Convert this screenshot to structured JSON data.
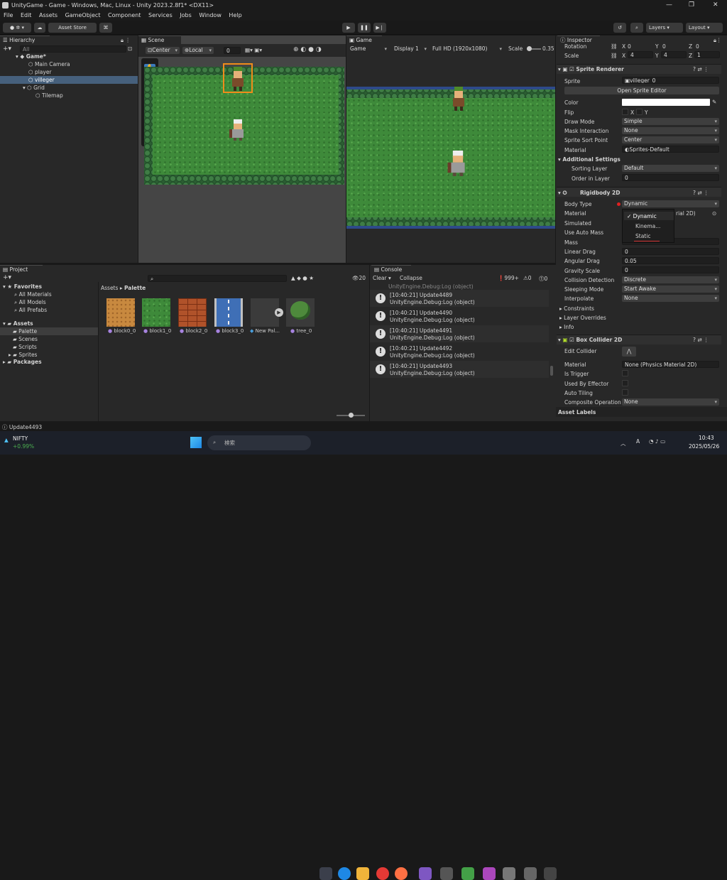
{
  "window": {
    "title": "UnityGame - Game - Windows, Mac, Linux - Unity 2023.2.8f1* <DX11>"
  },
  "menu": [
    "File",
    "Edit",
    "Assets",
    "GameObject",
    "Component",
    "Services",
    "Jobs",
    "Window",
    "Help"
  ],
  "toolbar": {
    "asset_store": "Asset Store",
    "layers": "Layers",
    "layout": "Layout"
  },
  "hierarchy": {
    "tab": "Hierarchy",
    "search_placeholder": "All",
    "items": [
      {
        "label": "Game*"
      },
      {
        "label": "Main Camera"
      },
      {
        "label": "player"
      },
      {
        "label": "villeger"
      },
      {
        "label": "Grid"
      },
      {
        "label": "Tilemap"
      }
    ]
  },
  "scene": {
    "tab": "Scene",
    "pivot": "Center",
    "space": "Local",
    "snap": "0"
  },
  "game": {
    "tab": "Game",
    "mode": "Game",
    "display": "Display 1",
    "resolution": "Full HD (1920x1080)",
    "scale_label": "Scale",
    "scale_value": "0.35"
  },
  "inspector": {
    "tab": "Inspector",
    "transform": {
      "rotation": "Rotation",
      "scale": "Scale",
      "rx": "0",
      "ry": "0",
      "rz": "0",
      "sx": "4",
      "sy": "4",
      "sz": "1",
      "x": "X",
      "y": "Y",
      "z": "Z"
    },
    "sprite_renderer": {
      "title": "Sprite Renderer",
      "sprite_label": "Sprite",
      "sprite_value": "villeger_0",
      "open_editor": "Open Sprite Editor",
      "color": "Color",
      "flip": "Flip",
      "flip_x": "X",
      "flip_y": "Y",
      "draw_mode": "Draw Mode",
      "draw_mode_value": "Simple",
      "mask_interaction": "Mask Interaction",
      "mask_value": "None",
      "sort_point": "Sprite Sort Point",
      "sort_point_value": "Center",
      "material": "Material",
      "material_value": "Sprites-Default",
      "additional": "Additional Settings",
      "sorting_layer": "Sorting Layer",
      "sorting_layer_value": "Default",
      "order": "Order in Layer",
      "order_value": "0"
    },
    "rigidbody": {
      "title": "Rigidbody 2D",
      "body_type": "Body Type",
      "body_type_value": "Dynamic",
      "material": "Material",
      "material_partial": "rial 2D)",
      "simulated": "Simulated",
      "auto_mass": "Use Auto Mass",
      "mass": "Mass",
      "linear_drag": "Linear Drag",
      "linear_drag_value": "0",
      "angular_drag": "Angular Drag",
      "angular_drag_value": "0.05",
      "gravity": "Gravity Scale",
      "gravity_value": "0",
      "collision": "Collision Detection",
      "collision_value": "Discrete",
      "sleeping": "Sleeping Mode",
      "sleeping_value": "Start Awake",
      "interpolate": "Interpolate",
      "interpolate_value": "None",
      "constraints": "Constraints",
      "layer_overrides": "Layer Overrides",
      "info": "Info",
      "dropdown": [
        "Dynamic",
        "Kinema...",
        "Static"
      ]
    },
    "box_collider": {
      "title": "Box Collider 2D",
      "edit": "Edit Collider",
      "material": "Material",
      "material_value": "None (Physics Material 2D)",
      "trigger": "Is Trigger",
      "effector": "Used By Effector",
      "auto_tiling": "Auto Tiling",
      "composite": "Composite Operation",
      "composite_value": "None"
    },
    "asset_labels": "Asset Labels"
  },
  "project": {
    "tab": "Project",
    "favorites": "Favorites",
    "fav_items": [
      "All Materials",
      "All Models",
      "All Prefabs"
    ],
    "assets": "Assets",
    "asset_items": [
      "Palette",
      "Scenes",
      "Scripts",
      "Sprites"
    ],
    "packages": "Packages",
    "breadcrumb_root": "Assets",
    "breadcrumb_sep": "▸",
    "breadcrumb_leaf": "Palette",
    "count": "20",
    "files": [
      "block0_0",
      "block1_0",
      "block2_0",
      "block3_0",
      "New Pal...",
      "tree_0"
    ]
  },
  "console": {
    "tab": "Console",
    "clear": "Clear",
    "collapse": "Collapse",
    "log_count": "999+",
    "warn_count": "0",
    "err_count": "0",
    "top_partial": "UnityEngine.Debug:Log (object)",
    "entries": [
      {
        "line1": "[10:40:21] Update4489",
        "line2": "UnityEngine.Debug:Log (object)"
      },
      {
        "line1": "[10:40:21] Update4490",
        "line2": "UnityEngine.Debug:Log (object)"
      },
      {
        "line1": "[10:40:21] Update4491",
        "line2": "UnityEngine.Debug:Log (object)"
      },
      {
        "line1": "[10:40:21] Update4492",
        "line2": "UnityEngine.Debug:Log (object)"
      },
      {
        "line1": "[10:40:21] Update4493",
        "line2": "UnityEngine.Debug:Log (object)"
      }
    ]
  },
  "statusbar": {
    "message": "Update4493"
  },
  "taskbar": {
    "stock_name": "NIFTY",
    "stock_change": "+0.99%",
    "search_placeholder": "検索",
    "time": "10:43",
    "date": "2025/05/26",
    "ime": "A"
  },
  "colors": {
    "accent": "#3a79bb",
    "selection": "#2c5d87",
    "orange": "#f08c1a"
  }
}
